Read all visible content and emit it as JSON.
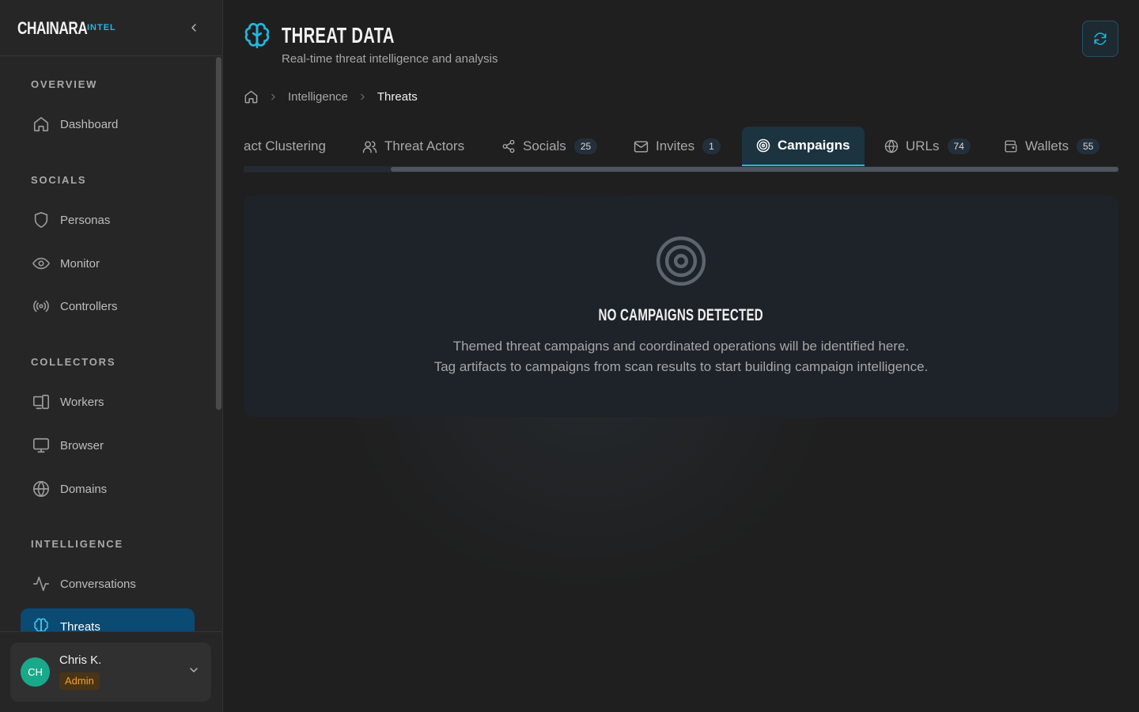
{
  "brand": {
    "name": "CHAINARA",
    "tag": "INTEL"
  },
  "sidebar": {
    "sections": [
      {
        "title": "OVERVIEW",
        "items": [
          {
            "label": "Dashboard",
            "icon": "home-icon"
          }
        ]
      },
      {
        "title": "SOCIALS",
        "items": [
          {
            "label": "Personas",
            "icon": "shield-icon"
          },
          {
            "label": "Monitor",
            "icon": "eye-icon"
          },
          {
            "label": "Controllers",
            "icon": "radio-icon"
          }
        ]
      },
      {
        "title": "COLLECTORS",
        "items": [
          {
            "label": "Workers",
            "icon": "devices-icon"
          },
          {
            "label": "Browser",
            "icon": "monitor-icon"
          },
          {
            "label": "Domains",
            "icon": "globe-icon"
          }
        ]
      },
      {
        "title": "INTELLIGENCE",
        "items": [
          {
            "label": "Conversations",
            "icon": "activity-icon"
          },
          {
            "label": "Threats",
            "icon": "brain-icon",
            "active": true
          }
        ]
      }
    ]
  },
  "user": {
    "name": "Chris K.",
    "initials": "CH",
    "role": "Admin"
  },
  "header": {
    "title": "THREAT DATA",
    "subtitle": "Real-time threat intelligence and analysis"
  },
  "breadcrumb": {
    "parent": "Intelligence",
    "current": "Threats"
  },
  "tabs": [
    {
      "label": "act Clustering",
      "badge": null
    },
    {
      "label": "Threat Actors",
      "badge": null
    },
    {
      "label": "Socials",
      "badge": "25"
    },
    {
      "label": "Invites",
      "badge": "1"
    },
    {
      "label": "Campaigns",
      "badge": null,
      "active": true
    },
    {
      "label": "URLs",
      "badge": "74"
    },
    {
      "label": "Wallets",
      "badge": "55"
    }
  ],
  "empty_state": {
    "title": "NO CAMPAIGNS DETECTED",
    "line1": "Themed threat campaigns and coordinated operations will be identified here.",
    "line2": "Tag artifacts to campaigns from scan results to start building campaign intelligence."
  },
  "colors": {
    "accent": "#22b8e0",
    "active_nav": "#0b4a72",
    "avatar": "#1aa88a",
    "role_badge": "#f0a12a"
  }
}
